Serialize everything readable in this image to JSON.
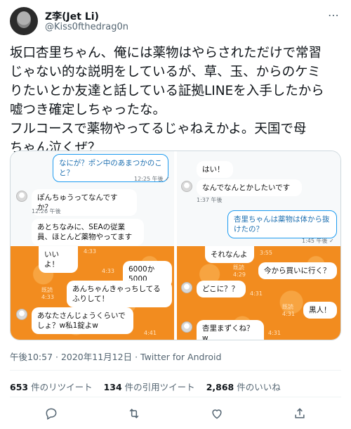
{
  "author": {
    "name": "Z李(Jet Li)",
    "handle": "@Kiss0fthedrag0n"
  },
  "tweet": {
    "text": "坂口杏里ちゃん、俺には薬物はやらされただけで常習\nじゃない的な説明をしているが、草、玉、からのケミ\nりたいとか友達と話している証拠LINEを入手したから\n嘘つき確定しちゃったな。\nフルコースで薬物やってるじゃねえかよ。天国で母\nちゃん泣くぜ？"
  },
  "media": {
    "left": {
      "top_bubbles": [
        {
          "text": "なにが？ポン中のあまつかのこと？",
          "time": "12:25 午後 ✓"
        },
        {
          "text": "ぽんちゅうってなんですか？",
          "time": "12:26 午後"
        },
        {
          "text": "あとちなみに、SEAの従業員、ほとんど薬物やってます",
          "time": ""
        }
      ],
      "orange_bubbles": [
        {
          "text": "いいよ！",
          "time": "4:33"
        },
        {
          "text": "6000か5000",
          "time": "4:33"
        },
        {
          "text": "あんちゃんきゃっちしてるふりして！",
          "time": "既読 4:33"
        },
        {
          "text": "あなたさんじょうくらいでしょ？w私1錠よw",
          "time": "4:41"
        }
      ]
    },
    "right": {
      "top_bubbles": [
        {
          "text": "はい！",
          "time": ""
        },
        {
          "text": "なんでなんとかしたいです",
          "time": "1:37 午後"
        },
        {
          "text": "杏里ちゃんは薬物は体から抜けたの？",
          "time": "1:45 午後 ✓"
        }
      ],
      "orange_bubbles": [
        {
          "text": "それなんよ",
          "time": "3:55"
        },
        {
          "text": "今から買いに行く？",
          "time": "既読 4:29"
        },
        {
          "text": "どこに？？",
          "time": "4:31"
        },
        {
          "text": "黒人！",
          "time": "既読 4:31"
        },
        {
          "text": "杏里まずくね？w",
          "time": "4:31"
        }
      ]
    }
  },
  "meta": {
    "timestamp": "午後10:57 · 2020年11月12日",
    "source": "Twitter for Android"
  },
  "stats": {
    "retweets_count": "653",
    "retweets_label": "件のリツイート",
    "quotes_count": "134",
    "quotes_label": "件の引用ツイート",
    "likes_count": "2,868",
    "likes_label": "件のいいね"
  },
  "icons": {
    "more": "more-icon",
    "reply": "reply-icon",
    "retweet": "retweet-icon",
    "like": "heart-icon",
    "share": "share-icon"
  },
  "colors": {
    "accent": "#1d9bf0",
    "line_orange": "#f28c1f",
    "muted": "#536471"
  }
}
